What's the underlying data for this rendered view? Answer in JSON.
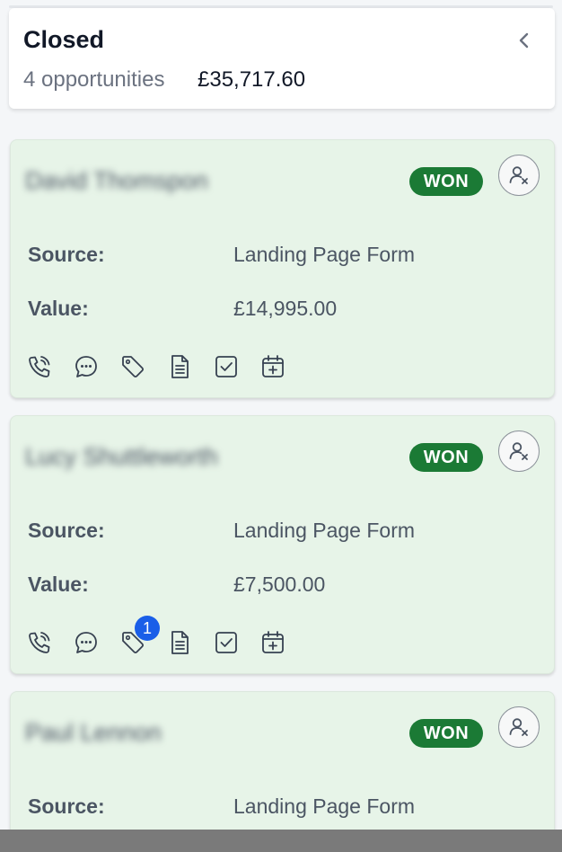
{
  "column": {
    "title": "Closed",
    "count_text": "4 opportunities",
    "total": "£35,717.60"
  },
  "cards": [
    {
      "name": "David Thomspon",
      "status": "WON",
      "source_label": "Source:",
      "source_value": "Landing Page Form",
      "value_label": "Value:",
      "value": "£14,995.00",
      "tag_count": ""
    },
    {
      "name": "Lucy Shuttleworth",
      "status": "WON",
      "source_label": "Source:",
      "source_value": "Landing Page Form",
      "value_label": "Value:",
      "value": "£7,500.00",
      "tag_count": "1"
    },
    {
      "name": "Paul Lennon",
      "status": "WON",
      "source_label": "Source:",
      "source_value": "Landing Page Form"
    }
  ],
  "actions": [
    "phone-icon",
    "chat-icon",
    "tag-icon",
    "note-icon",
    "task-icon",
    "calendar-add-icon"
  ],
  "colors": {
    "card_bg": "#e7f4e8",
    "won_badge": "#1b7a35",
    "notification": "#1a5ee8"
  }
}
